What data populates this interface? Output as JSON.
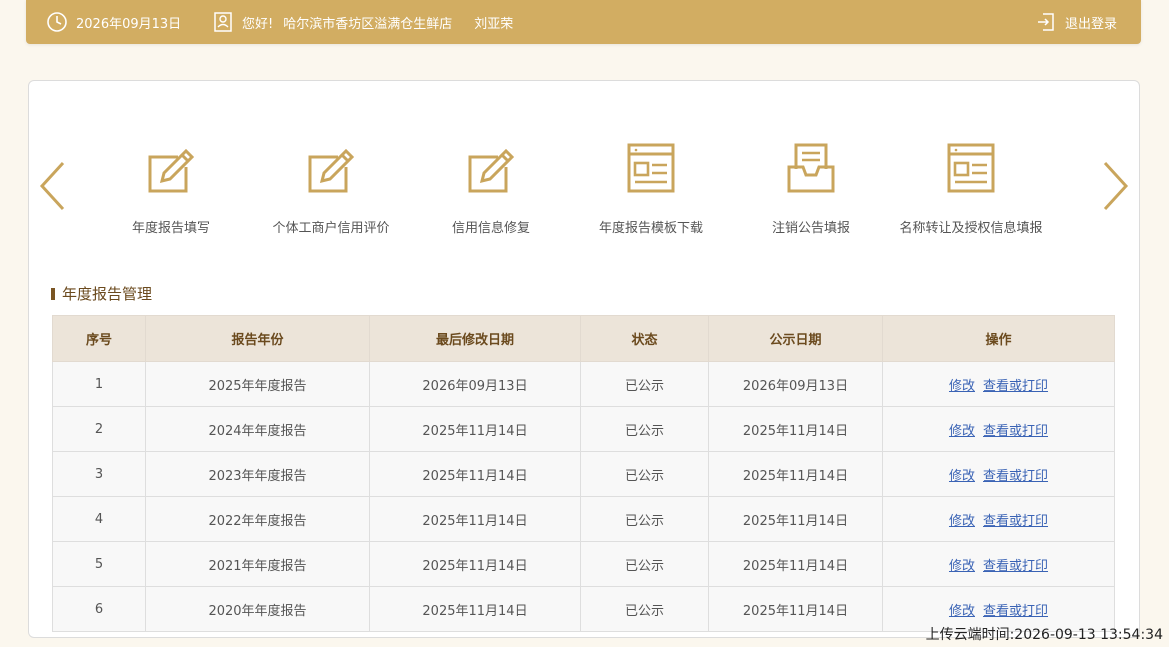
{
  "header": {
    "date": "2026年09月13日",
    "welcome": "您好!",
    "store": "哈尔滨市香坊区溢满仓生鲜店",
    "person": "刘亚荣",
    "logout_label": "退出登录"
  },
  "nav": {
    "tiles": [
      {
        "label": "年度报告填写",
        "icon": "edit-icon"
      },
      {
        "label": "个体工商户信用评价",
        "icon": "edit-icon"
      },
      {
        "label": "信用信息修复",
        "icon": "edit-icon"
      },
      {
        "label": "年度报告模板下载",
        "icon": "template-icon"
      },
      {
        "label": "注销公告填报",
        "icon": "inbox-icon"
      },
      {
        "label": "名称转让及授权信息填报",
        "icon": "template-icon"
      }
    ]
  },
  "section": {
    "title": "年度报告管理"
  },
  "table": {
    "columns": [
      "序号",
      "报告年份",
      "最后修改日期",
      "状态",
      "公示日期",
      "操作"
    ],
    "action_edit": "修改",
    "action_view": "查看或打印",
    "rows": [
      {
        "no": "1",
        "year": "2025年年度报告",
        "modified": "2026年09月13日",
        "status": "已公示",
        "published": "2026年09月13日"
      },
      {
        "no": "2",
        "year": "2024年年度报告",
        "modified": "2025年11月14日",
        "status": "已公示",
        "published": "2025年11月14日"
      },
      {
        "no": "3",
        "year": "2023年年度报告",
        "modified": "2025年11月14日",
        "status": "已公示",
        "published": "2025年11月14日"
      },
      {
        "no": "4",
        "year": "2022年年度报告",
        "modified": "2025年11月14日",
        "status": "已公示",
        "published": "2025年11月14日"
      },
      {
        "no": "5",
        "year": "2021年年度报告",
        "modified": "2025年11月14日",
        "status": "已公示",
        "published": "2025年11月14日"
      },
      {
        "no": "6",
        "year": "2020年年度报告",
        "modified": "2025年11月14日",
        "status": "已公示",
        "published": "2025年11月14日"
      }
    ]
  },
  "footer": {
    "upload_time": "上传云端时间:2026-09-13 13:54:34"
  },
  "colors": {
    "accent": "#d2ad62",
    "link": "#3a63b5",
    "header_bg": "#ece4d9"
  }
}
